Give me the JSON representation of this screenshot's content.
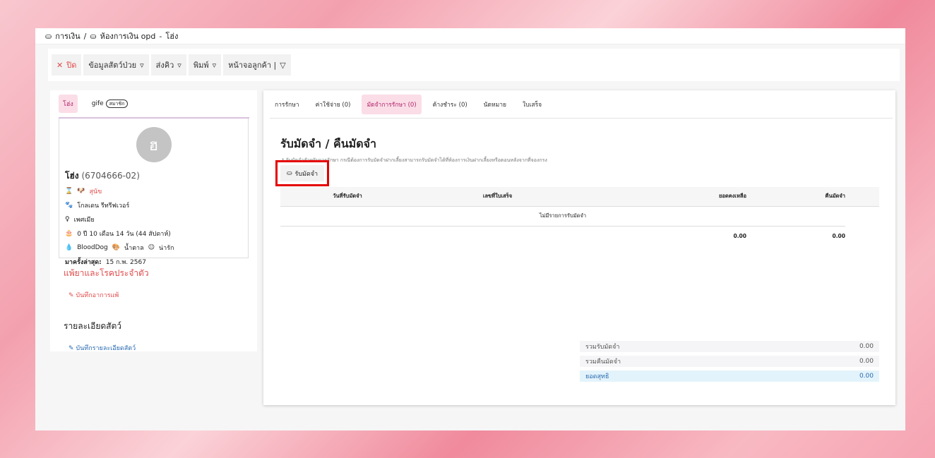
{
  "breadcrumb": {
    "root": "การเงิน",
    "room": "ห้องการเงิน opd",
    "sep": "-",
    "patient": "โฮ่ง"
  },
  "toolbar": {
    "close": "ปิด",
    "pet_info": "ข้อมูลสัตว์ป่วย",
    "queue": "ส่งคิว",
    "print": "พิมพ์",
    "customer_screen": "หน้าจอลูกค้า |"
  },
  "left": {
    "tabs": [
      {
        "label": "โฮ่ง"
      },
      {
        "label": "gife",
        "badge": "สมาชิก"
      }
    ],
    "avatar": "ฮ",
    "name": "โฮ่ง",
    "code": "(6704666-02)",
    "species": "สุนัข",
    "breed": "โกลเดน รีทรีฟเวอร์",
    "sex": "เพศเมีย",
    "age": "0 ปี 10 เดือน 14 วัน (44 สัปดาห์)",
    "blood": "BloodDog",
    "color": "น้ำตาล",
    "temper": "น่ารัก",
    "last_visit_label": "มาครั้งล่าสุด:",
    "last_visit": "15 ก.พ. 2567",
    "allergy_title": "แพ้ยาและโรคประจำตัว",
    "allergy_link": "บันทึกอาการแพ้",
    "detail_title": "รายละเอียดสัตว์",
    "detail_link": "บันทึกรายละเอียดสัตว์"
  },
  "right": {
    "tabs": [
      "การรักษา",
      "ค่าใช้จ่าย (0)",
      "มัดจำการรักษา (0)",
      "ค้างชำระ (0)",
      "นัดหมาย",
      "ใบเสร็จ"
    ],
    "title": "รับมัดจำ / คืนมัดจำ",
    "note": "* รับมัดจำสำหรับการรักษา กรณีต้องการรับมัดจำฝากเลี้ยงสามารถรับมัดจำได้ที่ห้องการเงินฝากเลี้ยงหรือตอนหลังจากที่จองกรง",
    "add_button": "รับมัดจำ",
    "table": {
      "headers": [
        "วันที่รับมัดจำ",
        "เลขที่ใบเสร็จ",
        "ยอดคงเหลือ",
        "คืนมัดจำ"
      ],
      "empty": "ไม่มีรายการรับมัดจำ",
      "sum_balance": "0.00",
      "sum_return": "0.00"
    },
    "totals": [
      {
        "label": "รวมรับมัดจำ",
        "value": "0.00"
      },
      {
        "label": "รวมคืนมัดจำ",
        "value": "0.00"
      },
      {
        "label": "ยอดสุทธิ",
        "value": "0.00"
      }
    ]
  },
  "colors": {
    "accent": "#b0246a",
    "danger": "#e24a4a",
    "link": "#2a6bb0"
  }
}
